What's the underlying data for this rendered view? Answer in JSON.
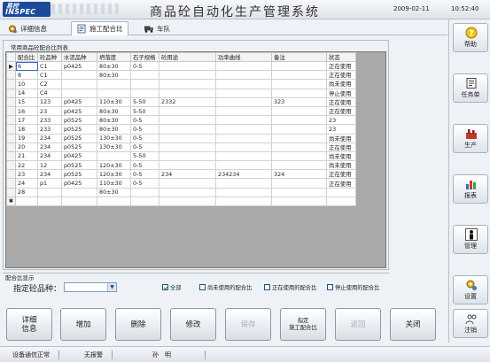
{
  "app": {
    "title": "商品砼自动化生产管理系统",
    "logo_cn": "易控",
    "logo_en": "INSPEC",
    "date": "2009-02-11",
    "time": "10:52:40"
  },
  "tabs": [
    {
      "label": "详细信息",
      "icon": "gear-icon"
    },
    {
      "label": "施工配合比",
      "icon": "document-icon"
    },
    {
      "label": "车队",
      "icon": "truck-icon"
    }
  ],
  "grid": {
    "caption": "常用商品砼配合比列表",
    "columns": [
      "配合比",
      "砼品种",
      "水泥品种",
      "坍落度",
      "石子规格",
      "砼用途",
      "功率曲线",
      "备注",
      "状态"
    ],
    "rows": [
      [
        "6",
        "C1",
        "p0425",
        "80±30",
        "0-5",
        "",
        "",
        "",
        "正在使用"
      ],
      [
        "8",
        "C1",
        "",
        "80±30",
        "",
        "",
        "",
        "",
        "正在使用"
      ],
      [
        "10",
        "C2",
        "",
        "",
        "",
        "",
        "",
        "",
        "尚未使用"
      ],
      [
        "14",
        "C4",
        "",
        "",
        "",
        "",
        "",
        "",
        "停止使用"
      ],
      [
        "15",
        "123",
        "p0425",
        "110±30",
        "5-50",
        "2332",
        "",
        "323",
        "正在使用"
      ],
      [
        "16",
        "23",
        "p0425",
        "80±30",
        "5-50",
        "",
        "",
        "",
        "正在使用"
      ],
      [
        "17",
        "233",
        "p0525",
        "80±30",
        "0-5",
        "",
        "",
        "",
        "23"
      ],
      [
        "18",
        "233",
        "p0525",
        "80±30",
        "0-5",
        "",
        "",
        "",
        "23"
      ],
      [
        "19",
        "234",
        "p0525",
        "130±30",
        "0-5",
        "",
        "",
        "",
        "尚未使用"
      ],
      [
        "20",
        "234",
        "p0525",
        "130±30",
        "0-5",
        "",
        "",
        "",
        "正在使用"
      ],
      [
        "21",
        "234",
        "p0425",
        "",
        "5-50",
        "",
        "",
        "",
        "尚未使用"
      ],
      [
        "22",
        "12",
        "p0525",
        "120±30",
        "0-5",
        "",
        "",
        "",
        "尚未使用"
      ],
      [
        "23",
        "234",
        "p0525",
        "120±30",
        "0-5",
        "234",
        "234234",
        "324",
        "正在使用"
      ],
      [
        "24",
        "p1",
        "p0425",
        "110±30",
        "0-5",
        "",
        "",
        "",
        "正在使用"
      ],
      [
        "28",
        "",
        "",
        "80±30",
        "",
        "",
        "",
        "",
        ""
      ]
    ],
    "current_row_marker": "▶",
    "new_row_marker": "✱"
  },
  "filter": {
    "caption": "配合比显示",
    "label": "指定砼品种：",
    "select_value": "",
    "options": [
      {
        "label": "全部",
        "checked": true
      },
      {
        "label": "尚未使用的配合比",
        "checked": false
      },
      {
        "label": "正在使用的配合比",
        "checked": false
      },
      {
        "label": "停止使用的配合比",
        "checked": false
      }
    ]
  },
  "buttons": {
    "details": "详细\n信息",
    "add": "增加",
    "delete": "删除",
    "modify": "修改",
    "save": "保存",
    "assign": "指定\n施工配合比",
    "back": "返回",
    "close": "关闭"
  },
  "sidebar": {
    "help": "帮助",
    "tasks": "任务单",
    "production": "生产",
    "reports": "报表",
    "management": "管理",
    "settings": "设置",
    "logout": "注销"
  },
  "status": {
    "comm": "设备通信正常",
    "alarm": "无报警",
    "user": "孙　明"
  },
  "colors": {
    "brand": "#1b4a9a",
    "accent": "#3168c8"
  }
}
